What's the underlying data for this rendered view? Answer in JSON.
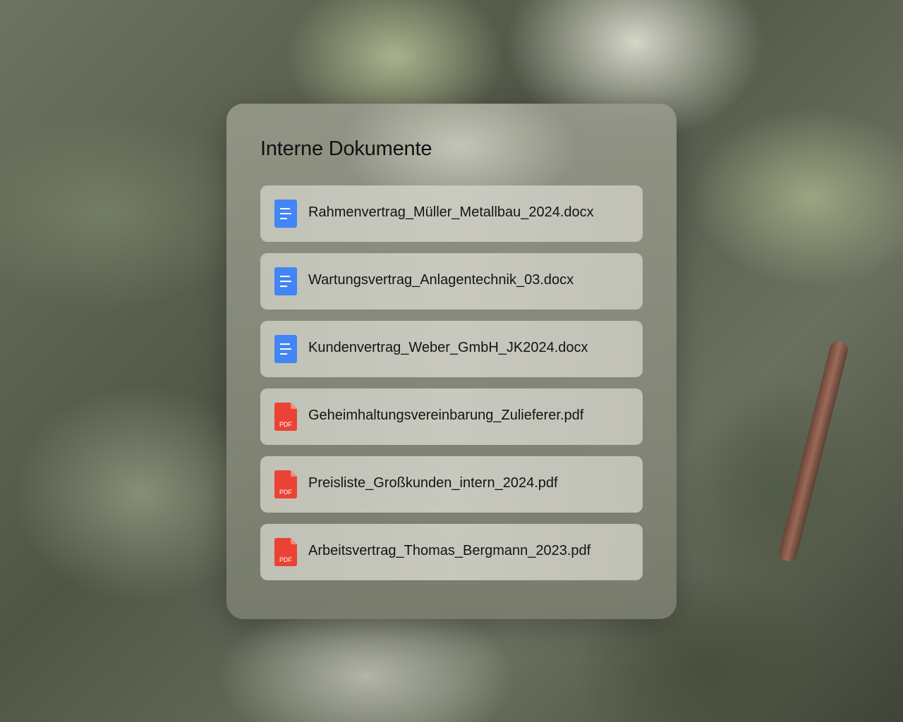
{
  "panel": {
    "title": "Interne Dokumente"
  },
  "files": [
    {
      "name": "Rahmenvertrag_Müller_Metallbau_2024.docx",
      "type": "docx",
      "icon": "doc-icon"
    },
    {
      "name": "Wartungsvertrag_Anlagentechnik_03.docx",
      "type": "docx",
      "icon": "doc-icon"
    },
    {
      "name": "Kundenvertrag_Weber_GmbH_JK2024.docx",
      "type": "docx",
      "icon": "doc-icon"
    },
    {
      "name": "Geheimhaltungsvereinbarung_Zulieferer.pdf",
      "type": "pdf",
      "icon": "pdf-icon",
      "icon_label": "PDF"
    },
    {
      "name": "Preisliste_Großkunden_intern_2024.pdf",
      "type": "pdf",
      "icon": "pdf-icon",
      "icon_label": "PDF"
    },
    {
      "name": "Arbeitsvertrag_Thomas_Bergmann_2023.pdf",
      "type": "pdf",
      "icon": "pdf-icon",
      "icon_label": "PDF"
    }
  ],
  "colors": {
    "doc_icon": "#4285f4",
    "pdf_icon": "#ea4335"
  }
}
